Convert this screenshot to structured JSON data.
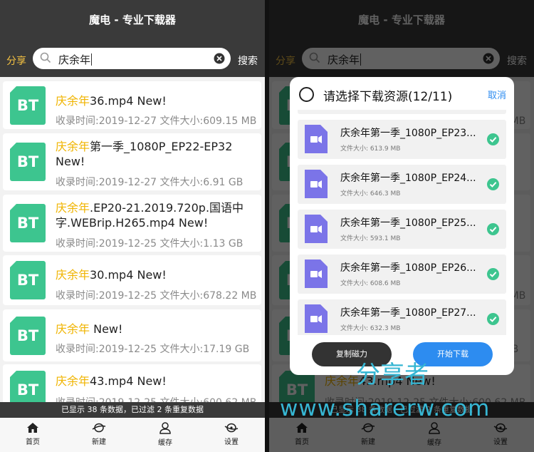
{
  "app": {
    "title": "魔电 - 专业下载器",
    "share_label": "分享",
    "search": {
      "value": "庆余年",
      "button_label": "搜索"
    }
  },
  "results": [
    {
      "badge": "BT",
      "keyword": "庆余年",
      "suffix": "36.mp4 New!",
      "meta": "收录时间:2019-12-27 文件大小:609.15 MB"
    },
    {
      "badge": "BT",
      "keyword": "庆余年",
      "suffix": "第一季_1080P_EP22-EP32 New!",
      "meta": "收录时间:2019-12-27 文件大小:6.91 GB"
    },
    {
      "badge": "BT",
      "keyword": "庆余年",
      "suffix": ".EP20-21.2019.720p.国语中字.WEBrip.H265.mp4 New!",
      "meta": "收录时间:2019-12-25 文件大小:1.13 GB"
    },
    {
      "badge": "BT",
      "keyword": "庆余年",
      "suffix": "30.mp4 New!",
      "meta": "收录时间:2019-12-25 文件大小:678.22 MB"
    },
    {
      "badge": "BT",
      "keyword": "庆余年",
      "suffix": " New!",
      "meta": "收录时间:2019-12-25 文件大小:17.19 GB"
    },
    {
      "badge": "BT",
      "keyword": "庆余年",
      "suffix": "43.mp4 New!",
      "meta": "收录时间:2019-12-25 文件大小:600.62 MB"
    }
  ],
  "status_text": "已显示 38 条数据，已过滤 2 条重复数据",
  "tabs": [
    {
      "label": "首页",
      "icon": "home-icon"
    },
    {
      "label": "新建",
      "icon": "new-icon"
    },
    {
      "label": "缓存",
      "icon": "cache-icon"
    },
    {
      "label": "设置",
      "icon": "settings-icon"
    }
  ],
  "dialog": {
    "title": "请选择下载资源(12/11)",
    "cancel_label": "取消",
    "items": [
      {
        "name": "庆余年第一季_1080P_EP23...",
        "size": "文件大小: 613.9 MB",
        "checked": true
      },
      {
        "name": "庆余年第一季_1080P_EP24...",
        "size": "文件大小: 646.3 MB",
        "checked": true
      },
      {
        "name": "庆余年第一季_1080P_EP25...",
        "size": "文件大小: 593.1 MB",
        "checked": true
      },
      {
        "name": "庆余年第一季_1080P_EP26...",
        "size": "文件大小: 608.6 MB",
        "checked": true
      },
      {
        "name": "庆余年第一季_1080P_EP27...",
        "size": "文件大小: 632.3 MB",
        "checked": true
      }
    ],
    "copy_button": "复制磁力",
    "start_button": "开始下载"
  },
  "watermark": {
    "line1": "分享者",
    "line2": "www.sharerw.com"
  },
  "colors": {
    "accent": "#f0b400",
    "bt_badge": "#3dc58f",
    "primary": "#2d8cf0",
    "check": "#3dc58f",
    "video_icon": "#7b74e8"
  }
}
